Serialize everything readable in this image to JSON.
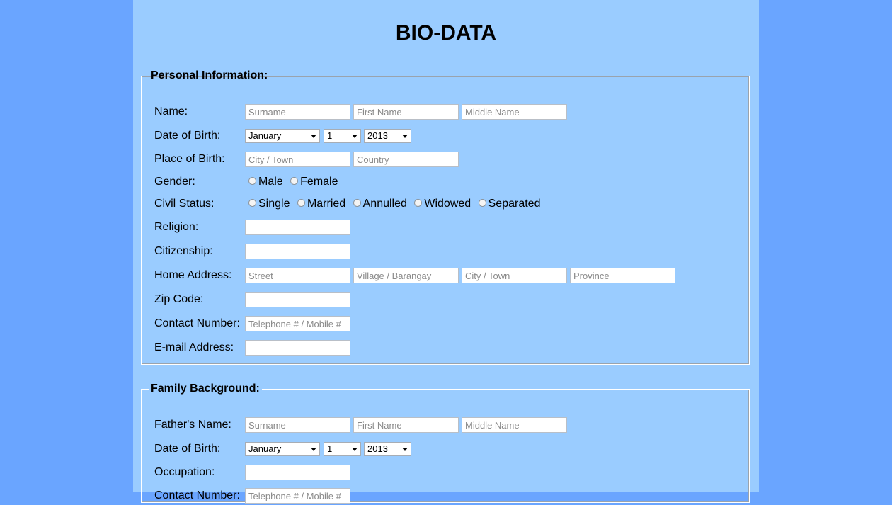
{
  "title": "BIO-DATA",
  "personal": {
    "legend": "Personal Information:",
    "name": {
      "label": "Name:",
      "surname": "Surname",
      "first": "First Name",
      "middle": "Middle Name"
    },
    "dob": {
      "label": "Date of Birth:",
      "month": "January",
      "day": "1",
      "year": "2013"
    },
    "pob": {
      "label": "Place of Birth:",
      "city": "City / Town",
      "country": "Country"
    },
    "gender": {
      "label": "Gender:",
      "options": [
        "Male",
        "Female"
      ]
    },
    "civil": {
      "label": "Civil Status:",
      "options": [
        "Single",
        "Married",
        "Annulled",
        "Widowed",
        "Separated"
      ]
    },
    "religion": {
      "label": "Religion:"
    },
    "citizenship": {
      "label": "Citizenship:"
    },
    "address": {
      "label": "Home Address:",
      "street": "Street",
      "village": "Village / Barangay",
      "city": "City / Town",
      "province": "Province"
    },
    "zip": {
      "label": "Zip Code:"
    },
    "contact": {
      "label": "Contact Number:",
      "placeholder": "Telephone # / Mobile #"
    },
    "email": {
      "label": "E-mail Address:"
    }
  },
  "family": {
    "legend": "Family Background:",
    "father": {
      "label": "Father's Name:",
      "surname": "Surname",
      "first": "First Name",
      "middle": "Middle Name"
    },
    "dob": {
      "label": "Date of Birth:",
      "month": "January",
      "day": "1",
      "year": "2013"
    },
    "occupation": {
      "label": "Occupation:"
    },
    "contact": {
      "label": "Contact Number:",
      "placeholder": "Telephone # / Mobile #"
    }
  }
}
